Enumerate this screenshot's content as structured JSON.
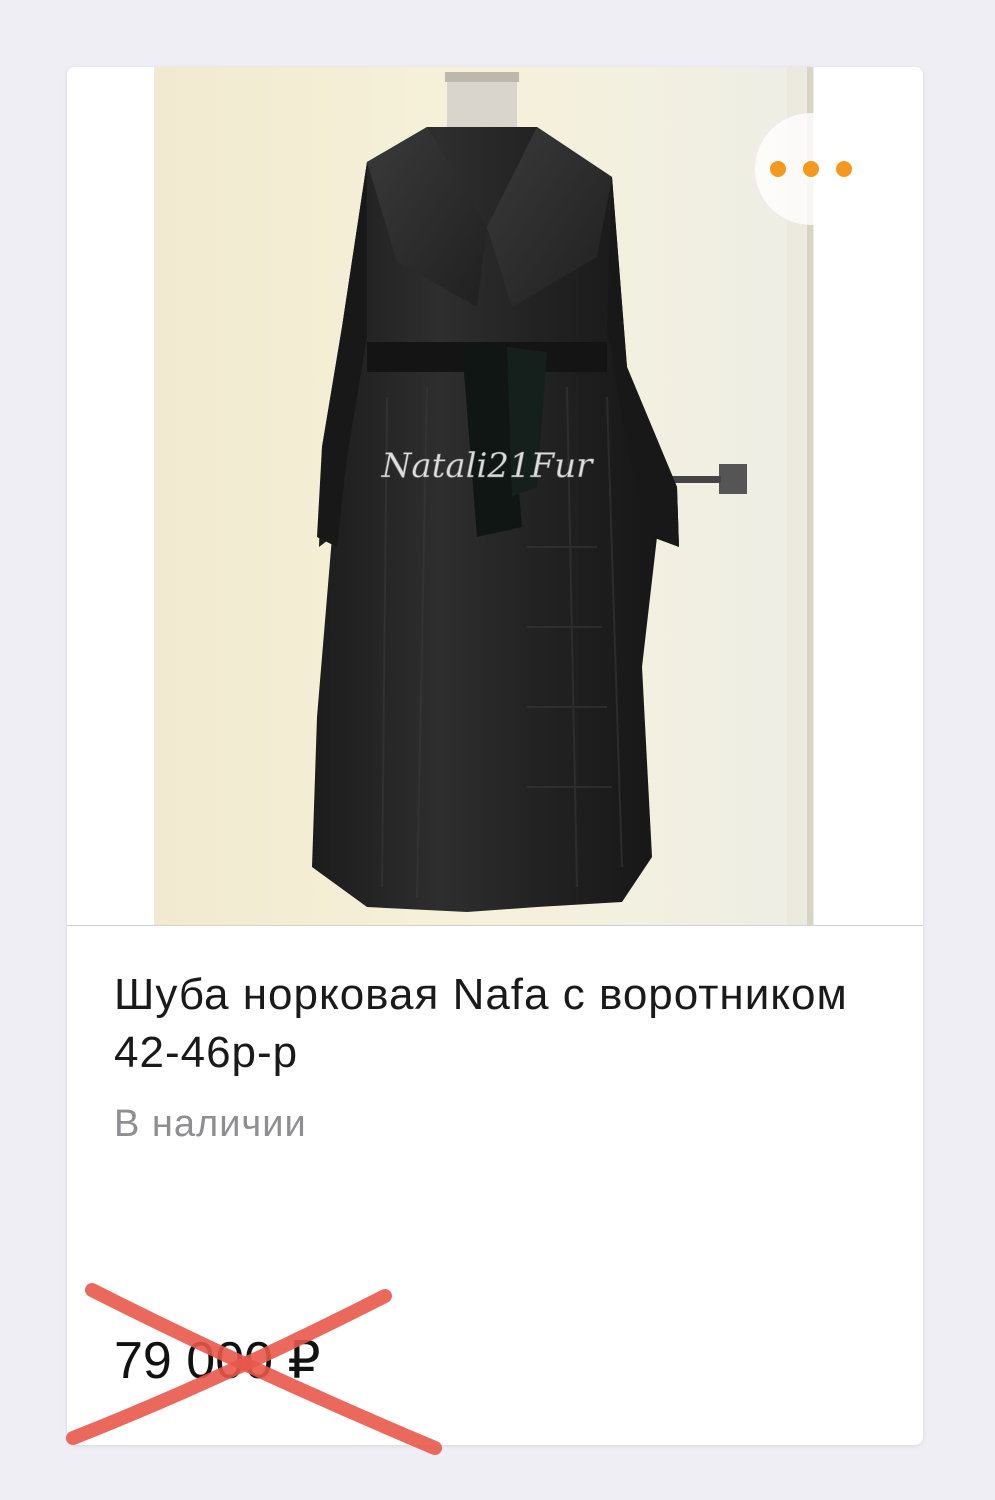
{
  "product": {
    "watermark": "Natali21Fur",
    "title": "Шуба норковая Nafa с воротником 42-46р-р",
    "availability": "В наличии",
    "price": "79 000 ₽",
    "price_crossed_out": true
  },
  "more_button": {
    "icon": "more-dots-icon",
    "dot_color": "#f39a1e"
  },
  "colors": {
    "background": "#efeef4",
    "card": "#ffffff",
    "title": "#1a1a1a",
    "availability": "#8e8e93",
    "cross": "#e8584a"
  }
}
